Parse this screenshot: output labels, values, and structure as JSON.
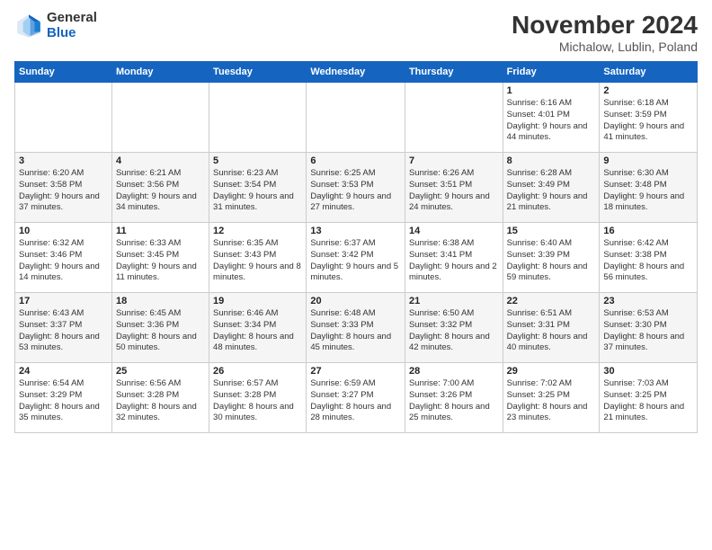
{
  "logo": {
    "general": "General",
    "blue": "Blue"
  },
  "title": {
    "month_year": "November 2024",
    "location": "Michalow, Lublin, Poland"
  },
  "days_of_week": [
    "Sunday",
    "Monday",
    "Tuesday",
    "Wednesday",
    "Thursday",
    "Friday",
    "Saturday"
  ],
  "weeks": [
    [
      {
        "day": "",
        "info": ""
      },
      {
        "day": "",
        "info": ""
      },
      {
        "day": "",
        "info": ""
      },
      {
        "day": "",
        "info": ""
      },
      {
        "day": "",
        "info": ""
      },
      {
        "day": "1",
        "info": "Sunrise: 6:16 AM\nSunset: 4:01 PM\nDaylight: 9 hours and 44 minutes."
      },
      {
        "day": "2",
        "info": "Sunrise: 6:18 AM\nSunset: 3:59 PM\nDaylight: 9 hours and 41 minutes."
      }
    ],
    [
      {
        "day": "3",
        "info": "Sunrise: 6:20 AM\nSunset: 3:58 PM\nDaylight: 9 hours and 37 minutes."
      },
      {
        "day": "4",
        "info": "Sunrise: 6:21 AM\nSunset: 3:56 PM\nDaylight: 9 hours and 34 minutes."
      },
      {
        "day": "5",
        "info": "Sunrise: 6:23 AM\nSunset: 3:54 PM\nDaylight: 9 hours and 31 minutes."
      },
      {
        "day": "6",
        "info": "Sunrise: 6:25 AM\nSunset: 3:53 PM\nDaylight: 9 hours and 27 minutes."
      },
      {
        "day": "7",
        "info": "Sunrise: 6:26 AM\nSunset: 3:51 PM\nDaylight: 9 hours and 24 minutes."
      },
      {
        "day": "8",
        "info": "Sunrise: 6:28 AM\nSunset: 3:49 PM\nDaylight: 9 hours and 21 minutes."
      },
      {
        "day": "9",
        "info": "Sunrise: 6:30 AM\nSunset: 3:48 PM\nDaylight: 9 hours and 18 minutes."
      }
    ],
    [
      {
        "day": "10",
        "info": "Sunrise: 6:32 AM\nSunset: 3:46 PM\nDaylight: 9 hours and 14 minutes."
      },
      {
        "day": "11",
        "info": "Sunrise: 6:33 AM\nSunset: 3:45 PM\nDaylight: 9 hours and 11 minutes."
      },
      {
        "day": "12",
        "info": "Sunrise: 6:35 AM\nSunset: 3:43 PM\nDaylight: 9 hours and 8 minutes."
      },
      {
        "day": "13",
        "info": "Sunrise: 6:37 AM\nSunset: 3:42 PM\nDaylight: 9 hours and 5 minutes."
      },
      {
        "day": "14",
        "info": "Sunrise: 6:38 AM\nSunset: 3:41 PM\nDaylight: 9 hours and 2 minutes."
      },
      {
        "day": "15",
        "info": "Sunrise: 6:40 AM\nSunset: 3:39 PM\nDaylight: 8 hours and 59 minutes."
      },
      {
        "day": "16",
        "info": "Sunrise: 6:42 AM\nSunset: 3:38 PM\nDaylight: 8 hours and 56 minutes."
      }
    ],
    [
      {
        "day": "17",
        "info": "Sunrise: 6:43 AM\nSunset: 3:37 PM\nDaylight: 8 hours and 53 minutes."
      },
      {
        "day": "18",
        "info": "Sunrise: 6:45 AM\nSunset: 3:36 PM\nDaylight: 8 hours and 50 minutes."
      },
      {
        "day": "19",
        "info": "Sunrise: 6:46 AM\nSunset: 3:34 PM\nDaylight: 8 hours and 48 minutes."
      },
      {
        "day": "20",
        "info": "Sunrise: 6:48 AM\nSunset: 3:33 PM\nDaylight: 8 hours and 45 minutes."
      },
      {
        "day": "21",
        "info": "Sunrise: 6:50 AM\nSunset: 3:32 PM\nDaylight: 8 hours and 42 minutes."
      },
      {
        "day": "22",
        "info": "Sunrise: 6:51 AM\nSunset: 3:31 PM\nDaylight: 8 hours and 40 minutes."
      },
      {
        "day": "23",
        "info": "Sunrise: 6:53 AM\nSunset: 3:30 PM\nDaylight: 8 hours and 37 minutes."
      }
    ],
    [
      {
        "day": "24",
        "info": "Sunrise: 6:54 AM\nSunset: 3:29 PM\nDaylight: 8 hours and 35 minutes."
      },
      {
        "day": "25",
        "info": "Sunrise: 6:56 AM\nSunset: 3:28 PM\nDaylight: 8 hours and 32 minutes."
      },
      {
        "day": "26",
        "info": "Sunrise: 6:57 AM\nSunset: 3:28 PM\nDaylight: 8 hours and 30 minutes."
      },
      {
        "day": "27",
        "info": "Sunrise: 6:59 AM\nSunset: 3:27 PM\nDaylight: 8 hours and 28 minutes."
      },
      {
        "day": "28",
        "info": "Sunrise: 7:00 AM\nSunset: 3:26 PM\nDaylight: 8 hours and 25 minutes."
      },
      {
        "day": "29",
        "info": "Sunrise: 7:02 AM\nSunset: 3:25 PM\nDaylight: 8 hours and 23 minutes."
      },
      {
        "day": "30",
        "info": "Sunrise: 7:03 AM\nSunset: 3:25 PM\nDaylight: 8 hours and 21 minutes."
      }
    ]
  ]
}
